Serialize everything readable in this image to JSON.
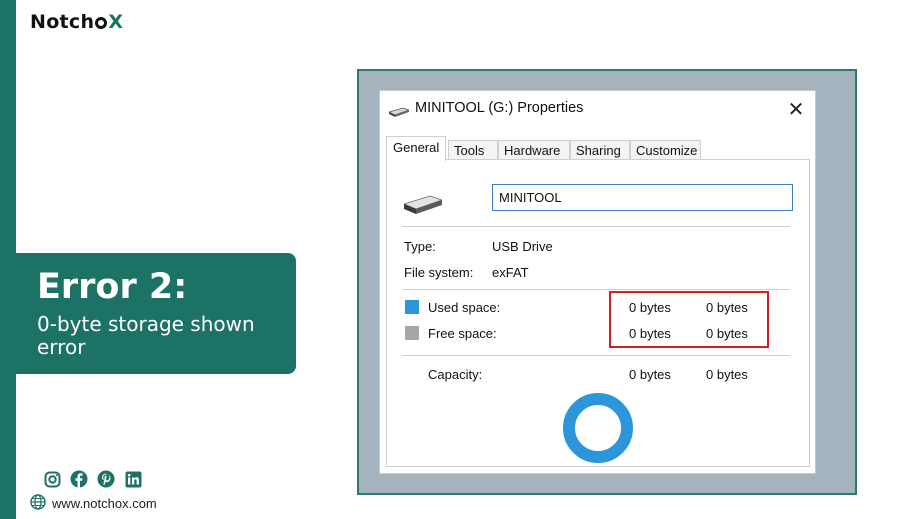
{
  "brand": {
    "logo_text_pre": "Notch",
    "logo_text_post": "X"
  },
  "error_card": {
    "title": "Error 2:",
    "subtitle": "0-byte storage shown error"
  },
  "footer": {
    "social_icons": [
      "instagram-icon",
      "facebook-icon",
      "pinterest-icon",
      "linkedin-icon"
    ],
    "website": "www.notchox.com"
  },
  "dialog": {
    "title": "MINITOOL (G:) Properties",
    "close_label": "✕",
    "tabs": [
      {
        "label": "General",
        "active": true
      },
      {
        "label": "Tools"
      },
      {
        "label": "Hardware"
      },
      {
        "label": "Sharing"
      },
      {
        "label": "Customize"
      }
    ],
    "volume_name": "MINITOOL",
    "type_label": "Type:",
    "type_value": "USB Drive",
    "fs_label": "File system:",
    "fs_value": "exFAT",
    "used": {
      "label": "Used space:",
      "bytes": "0 bytes",
      "size": "0 bytes",
      "color": "#2d96db"
    },
    "free": {
      "label": "Free space:",
      "bytes": "0 bytes",
      "size": "0 bytes",
      "color": "#a6a6a6"
    },
    "capacity": {
      "label": "Capacity:",
      "bytes": "0 bytes",
      "size": "0 bytes"
    }
  },
  "colors": {
    "brand_teal": "#1d7266",
    "highlight_red": "#d11f26",
    "pie_blue": "#2d96db"
  }
}
